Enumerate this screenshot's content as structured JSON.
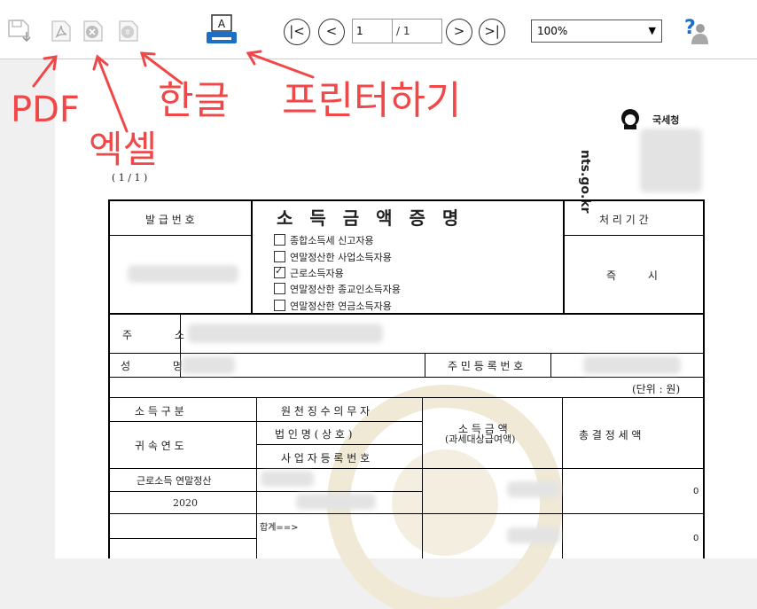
{
  "toolbar": {
    "page_current": "1",
    "page_total": "/ 1",
    "zoom": "100%",
    "nav": {
      "first": "|<",
      "prev": "<",
      "next": ">",
      "last": ">|"
    }
  },
  "annotations": {
    "pdf": "PDF",
    "excel": "엑셀",
    "hangul": "한글",
    "print": "프린터하기"
  },
  "logo": {
    "org": "국세청",
    "site": "nts.go.kr"
  },
  "page_indicator": "( 1 / 1 )",
  "form": {
    "issue_no_label": "발 급 번 호",
    "title": "소 득 금 액 증 명",
    "period_label": "처 리 기 간",
    "period_value": "즉 시",
    "options": [
      {
        "label": "종합소득세 신고자용",
        "checked": false
      },
      {
        "label": "연말정산한 사업소득자용",
        "checked": false
      },
      {
        "label": "근로소득자용",
        "checked": true
      },
      {
        "label": "연말정산한 종교인소득자용",
        "checked": false
      },
      {
        "label": "연말정산한 연금소득자용",
        "checked": false
      }
    ],
    "address_label": "주 소",
    "name_label": "성 명",
    "rrn_label": "주 민 등 록 번 호",
    "unit": "(단위 : 원)",
    "income_type_label": "소 득 구 분",
    "year_label": "귀 속 연 도",
    "withholder_label": "원 천 징 수 의 무 자",
    "corp_name_label": "법 인 명 ( 상 호 )",
    "biz_no_label": "사 업 자 등 록 번 호",
    "income_amount_label": "소 득 금 액",
    "income_amount_sub": "(과세대상급여액)",
    "tax_label": "총 결 정 세 액",
    "row_income_type": "근로소득 연말정산",
    "row_year": "2020",
    "row_tax": "0",
    "total_label": "합계==>",
    "total_tax": "0"
  },
  "colors": {
    "annotation": "#f04848",
    "printer": "#1c6fc4"
  }
}
